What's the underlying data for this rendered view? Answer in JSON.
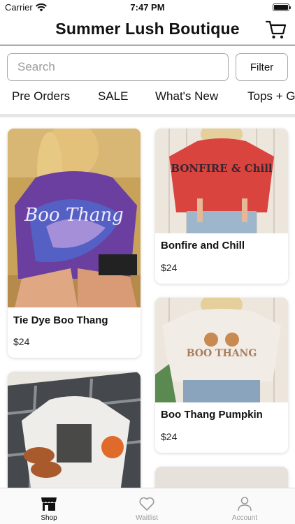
{
  "status_bar": {
    "carrier": "Carrier",
    "time": "7:47 PM"
  },
  "header": {
    "title": "Summer Lush Boutique"
  },
  "search": {
    "placeholder": "Search",
    "filter_label": "Filter"
  },
  "categories": [
    "Pre Orders",
    "SALE",
    "What's New",
    "Tops + G"
  ],
  "products": [
    {
      "name": "Tie Dye Boo Thang",
      "price": "$24",
      "shirt_text": "Boo Thang"
    },
    {
      "name": "Bonfire and Chill",
      "price": "$24",
      "shirt_text": "BONFIRE & Chill"
    },
    {
      "name": "Boo Thang Pumpkin",
      "price": "$24",
      "shirt_text": "BOO THANG"
    }
  ],
  "tab_bar": {
    "items": [
      {
        "label": "Shop",
        "icon": "shop-icon",
        "active": true
      },
      {
        "label": "Waitlist",
        "icon": "heart-icon",
        "active": false
      },
      {
        "label": "Account",
        "icon": "account-icon",
        "active": false
      }
    ]
  },
  "colors": {
    "tab_active": "#111111",
    "tab_inactive": "#9a9a9a",
    "divider": "#e6e6e6"
  }
}
